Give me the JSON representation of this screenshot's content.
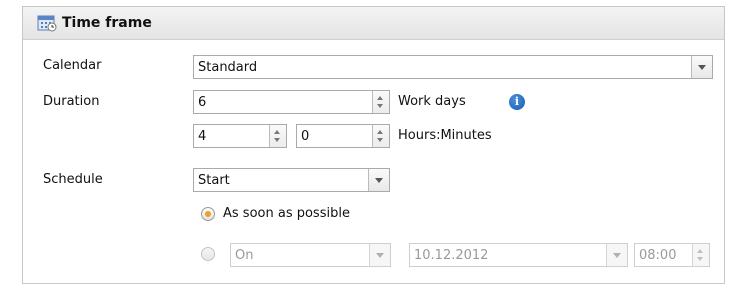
{
  "header": {
    "title": "Time frame",
    "icon": "calendar-icon"
  },
  "calendar": {
    "label": "Calendar",
    "value": "Standard"
  },
  "duration": {
    "label": "Duration",
    "days_value": "6",
    "days_unit": "Work days",
    "hours_value": "4",
    "minutes_value": "0",
    "time_unit": "Hours:Minutes",
    "info_icon": "info-icon"
  },
  "schedule": {
    "label": "Schedule",
    "value": "Start",
    "option_asap": "As soon as possible",
    "option_on_value": "On",
    "date_value": "10.12.2012",
    "time_value": "08:00"
  },
  "colors": {
    "accent_radio": "#f0a020",
    "info_icon": "#1a5cb0"
  }
}
